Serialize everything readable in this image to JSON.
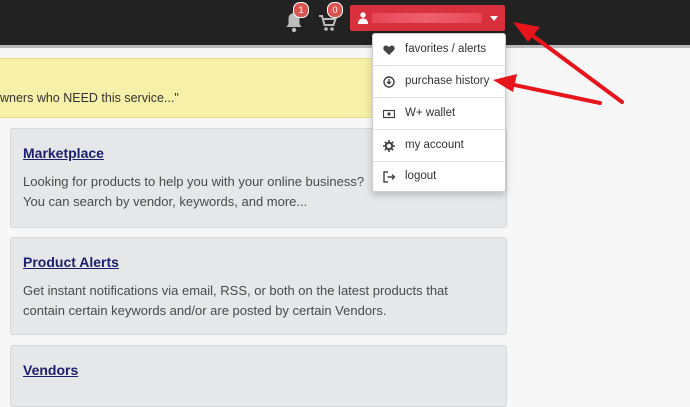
{
  "header": {
    "notifications_count": "1",
    "cart_count": "0",
    "user_menu_name": "",
    "accent_color": "#d8303d"
  },
  "notice": {
    "text": "wners who NEED this service...\""
  },
  "cards": [
    {
      "title": "Marketplace",
      "lines": [
        "Looking for products to help you with your online business?",
        "You can search by vendor, keywords, and more..."
      ]
    },
    {
      "title": "Product Alerts",
      "lines": [
        "Get instant notifications via email, RSS, or both on the latest products that",
        "contain certain keywords and/or are posted by certain Vendors."
      ]
    },
    {
      "title": "Vendors",
      "lines": []
    }
  ],
  "user_menu": {
    "items": [
      {
        "label": "favorites / alerts",
        "icon": "heart-icon"
      },
      {
        "label": "purchase history",
        "icon": "download-icon"
      },
      {
        "label": "W+ wallet",
        "icon": "wallet-icon"
      },
      {
        "label": "my account",
        "icon": "gear-icon"
      },
      {
        "label": "logout",
        "icon": "logout-icon"
      }
    ]
  },
  "annotation_color": "#e8141b"
}
